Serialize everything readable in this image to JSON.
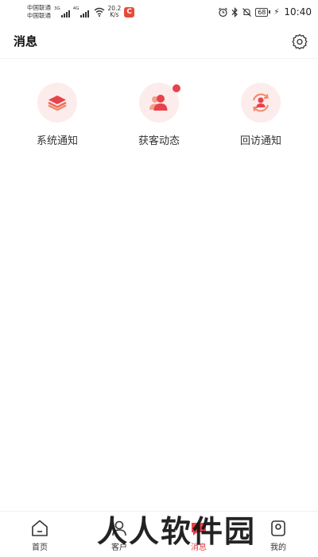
{
  "status_bar": {
    "carrier1": "中国联通",
    "carrier2": "中国联通",
    "net1": "3G",
    "net2": "4G",
    "speed_value": "20.2",
    "speed_unit": "K/s",
    "app_badge": "C",
    "battery": "68",
    "time": "10:40"
  },
  "header": {
    "title": "消息"
  },
  "categories": [
    {
      "label": "系统通知",
      "icon": "layers-icon",
      "badge": false
    },
    {
      "label": "获客动态",
      "icon": "users-icon",
      "badge": true
    },
    {
      "label": "回访通知",
      "icon": "user-refresh-icon",
      "badge": false
    }
  ],
  "bottom_nav": [
    {
      "label": "首页",
      "icon": "home-icon"
    },
    {
      "label": "客户",
      "icon": "customer-icon"
    },
    {
      "label": "消息",
      "icon": "message-icon"
    },
    {
      "label": "我的",
      "icon": "profile-icon"
    }
  ],
  "watermark": "人人软件园",
  "colors": {
    "accent": "#e8434a",
    "icon_bg": "#fdecec"
  }
}
